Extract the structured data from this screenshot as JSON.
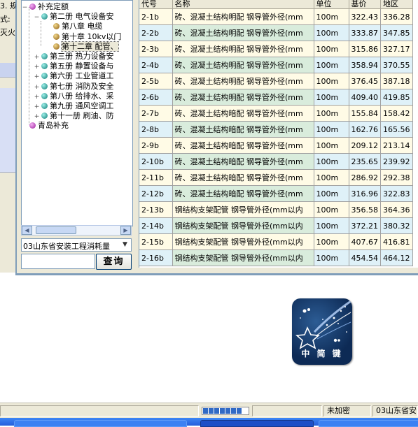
{
  "left_window": {
    "lines": [
      "3. 规",
      "式:",
      "灭火"
    ]
  },
  "tree": {
    "items": [
      {
        "label": "补充定额",
        "level": 0,
        "bullet": "purple",
        "expander": "−"
      },
      {
        "label": "第二册 电气设备安",
        "level": 1,
        "bullet": "teal",
        "expander": "−"
      },
      {
        "label": "第八章 电缆",
        "level": 2,
        "bullet": "brown",
        "expander": ""
      },
      {
        "label": "第十章 10kv以门",
        "level": 2,
        "bullet": "brown",
        "expander": ""
      },
      {
        "label": "第十二章 配管、",
        "level": 2,
        "bullet": "brown",
        "expander": "",
        "selected": true
      },
      {
        "label": "第三册 热力设备安",
        "level": 1,
        "bullet": "teal",
        "expander": "+"
      },
      {
        "label": "第五册 静置设备与",
        "level": 1,
        "bullet": "teal",
        "expander": "+"
      },
      {
        "label": "第六册 工业管道工",
        "level": 1,
        "bullet": "teal",
        "expander": "+"
      },
      {
        "label": "第七册 消防及安全",
        "level": 1,
        "bullet": "teal",
        "expander": "+"
      },
      {
        "label": "第八册 给排水、采",
        "level": 1,
        "bullet": "teal",
        "expander": "+"
      },
      {
        "label": "第九册 通风空调工",
        "level": 1,
        "bullet": "teal",
        "expander": "+"
      },
      {
        "label": "第十一册 刷油、防",
        "level": 1,
        "bullet": "teal",
        "expander": "+"
      },
      {
        "label": "青岛补充",
        "level": 0,
        "bullet": "purple",
        "expander": ""
      }
    ]
  },
  "combo": {
    "value": "03山东省安装工程消耗量"
  },
  "search": {
    "value": "",
    "button_label": "查询"
  },
  "grid": {
    "columns": [
      "代号",
      "名称",
      "单位",
      "基价",
      "地区"
    ],
    "rows": [
      {
        "code": "2-1b",
        "name": "砖、混凝土结构明配 钢导管外径(mm",
        "unit": "100m",
        "base": "322.43",
        "region": "336.28"
      },
      {
        "code": "2-2b",
        "name": "砖、混凝土结构明配 钢导管外径(mm",
        "unit": "100m",
        "base": "333.87",
        "region": "347.85"
      },
      {
        "code": "2-3b",
        "name": "砖、混凝土结构明配 钢导管外径(mm",
        "unit": "100m",
        "base": "315.86",
        "region": "327.17"
      },
      {
        "code": "2-4b",
        "name": "砖、混凝土结构明配 钢导管外径(mm",
        "unit": "100m",
        "base": "358.94",
        "region": "370.55"
      },
      {
        "code": "2-5b",
        "name": "砖、混凝土结构明配 钢导管外径(mm",
        "unit": "100m",
        "base": "376.45",
        "region": "387.18"
      },
      {
        "code": "2-6b",
        "name": "砖、混凝土结构明配 钢导管外径(mm",
        "unit": "100m",
        "base": "409.40",
        "region": "419.85"
      },
      {
        "code": "2-7b",
        "name": "砖、混凝土结构暗配 钢导管外径(mm",
        "unit": "100m",
        "base": "155.84",
        "region": "158.42"
      },
      {
        "code": "2-8b",
        "name": "砖、混凝土结构暗配 钢导管外径(mm",
        "unit": "100m",
        "base": "162.76",
        "region": "165.56"
      },
      {
        "code": "2-9b",
        "name": "砖、混凝土结构暗配 钢导管外径(mm",
        "unit": "100m",
        "base": "209.12",
        "region": "213.14"
      },
      {
        "code": "2-10b",
        "name": "砖、混凝土结构暗配 钢导管外径(mm",
        "unit": "100m",
        "base": "235.65",
        "region": "239.92"
      },
      {
        "code": "2-11b",
        "name": "砖、混凝土结构暗配 钢导管外径(mm",
        "unit": "100m",
        "base": "286.92",
        "region": "292.38"
      },
      {
        "code": "2-12b",
        "name": "砖、混凝土结构暗配 钢导管外径(mm",
        "unit": "100m",
        "base": "316.96",
        "region": "322.83"
      },
      {
        "code": "2-13b",
        "name": "钢结构支架配管 钢导管外径(mm以内",
        "unit": "100m",
        "base": "356.58",
        "region": "364.36"
      },
      {
        "code": "2-14b",
        "name": "钢结构支架配管 钢导管外径(mm以内",
        "unit": "100m",
        "base": "372.21",
        "region": "380.32"
      },
      {
        "code": "2-15b",
        "name": "钢结构支架配管 钢导管外径(mm以内",
        "unit": "100m",
        "base": "407.67",
        "region": "416.81"
      },
      {
        "code": "2-16b",
        "name": "钢结构支架配管 钢导管外径(mm以内",
        "unit": "100m",
        "base": "454.54",
        "region": "464.12"
      }
    ]
  },
  "logo": {
    "text": "中 简 键"
  },
  "status": {
    "progress_fraction": 0.85,
    "encryption": "未加密",
    "database": "03山东省安"
  },
  "colors": {
    "row_odd": "#fffbe6",
    "row_even": "#dff1f8",
    "selection": "#316ac5",
    "taskbar": "#245edb"
  }
}
